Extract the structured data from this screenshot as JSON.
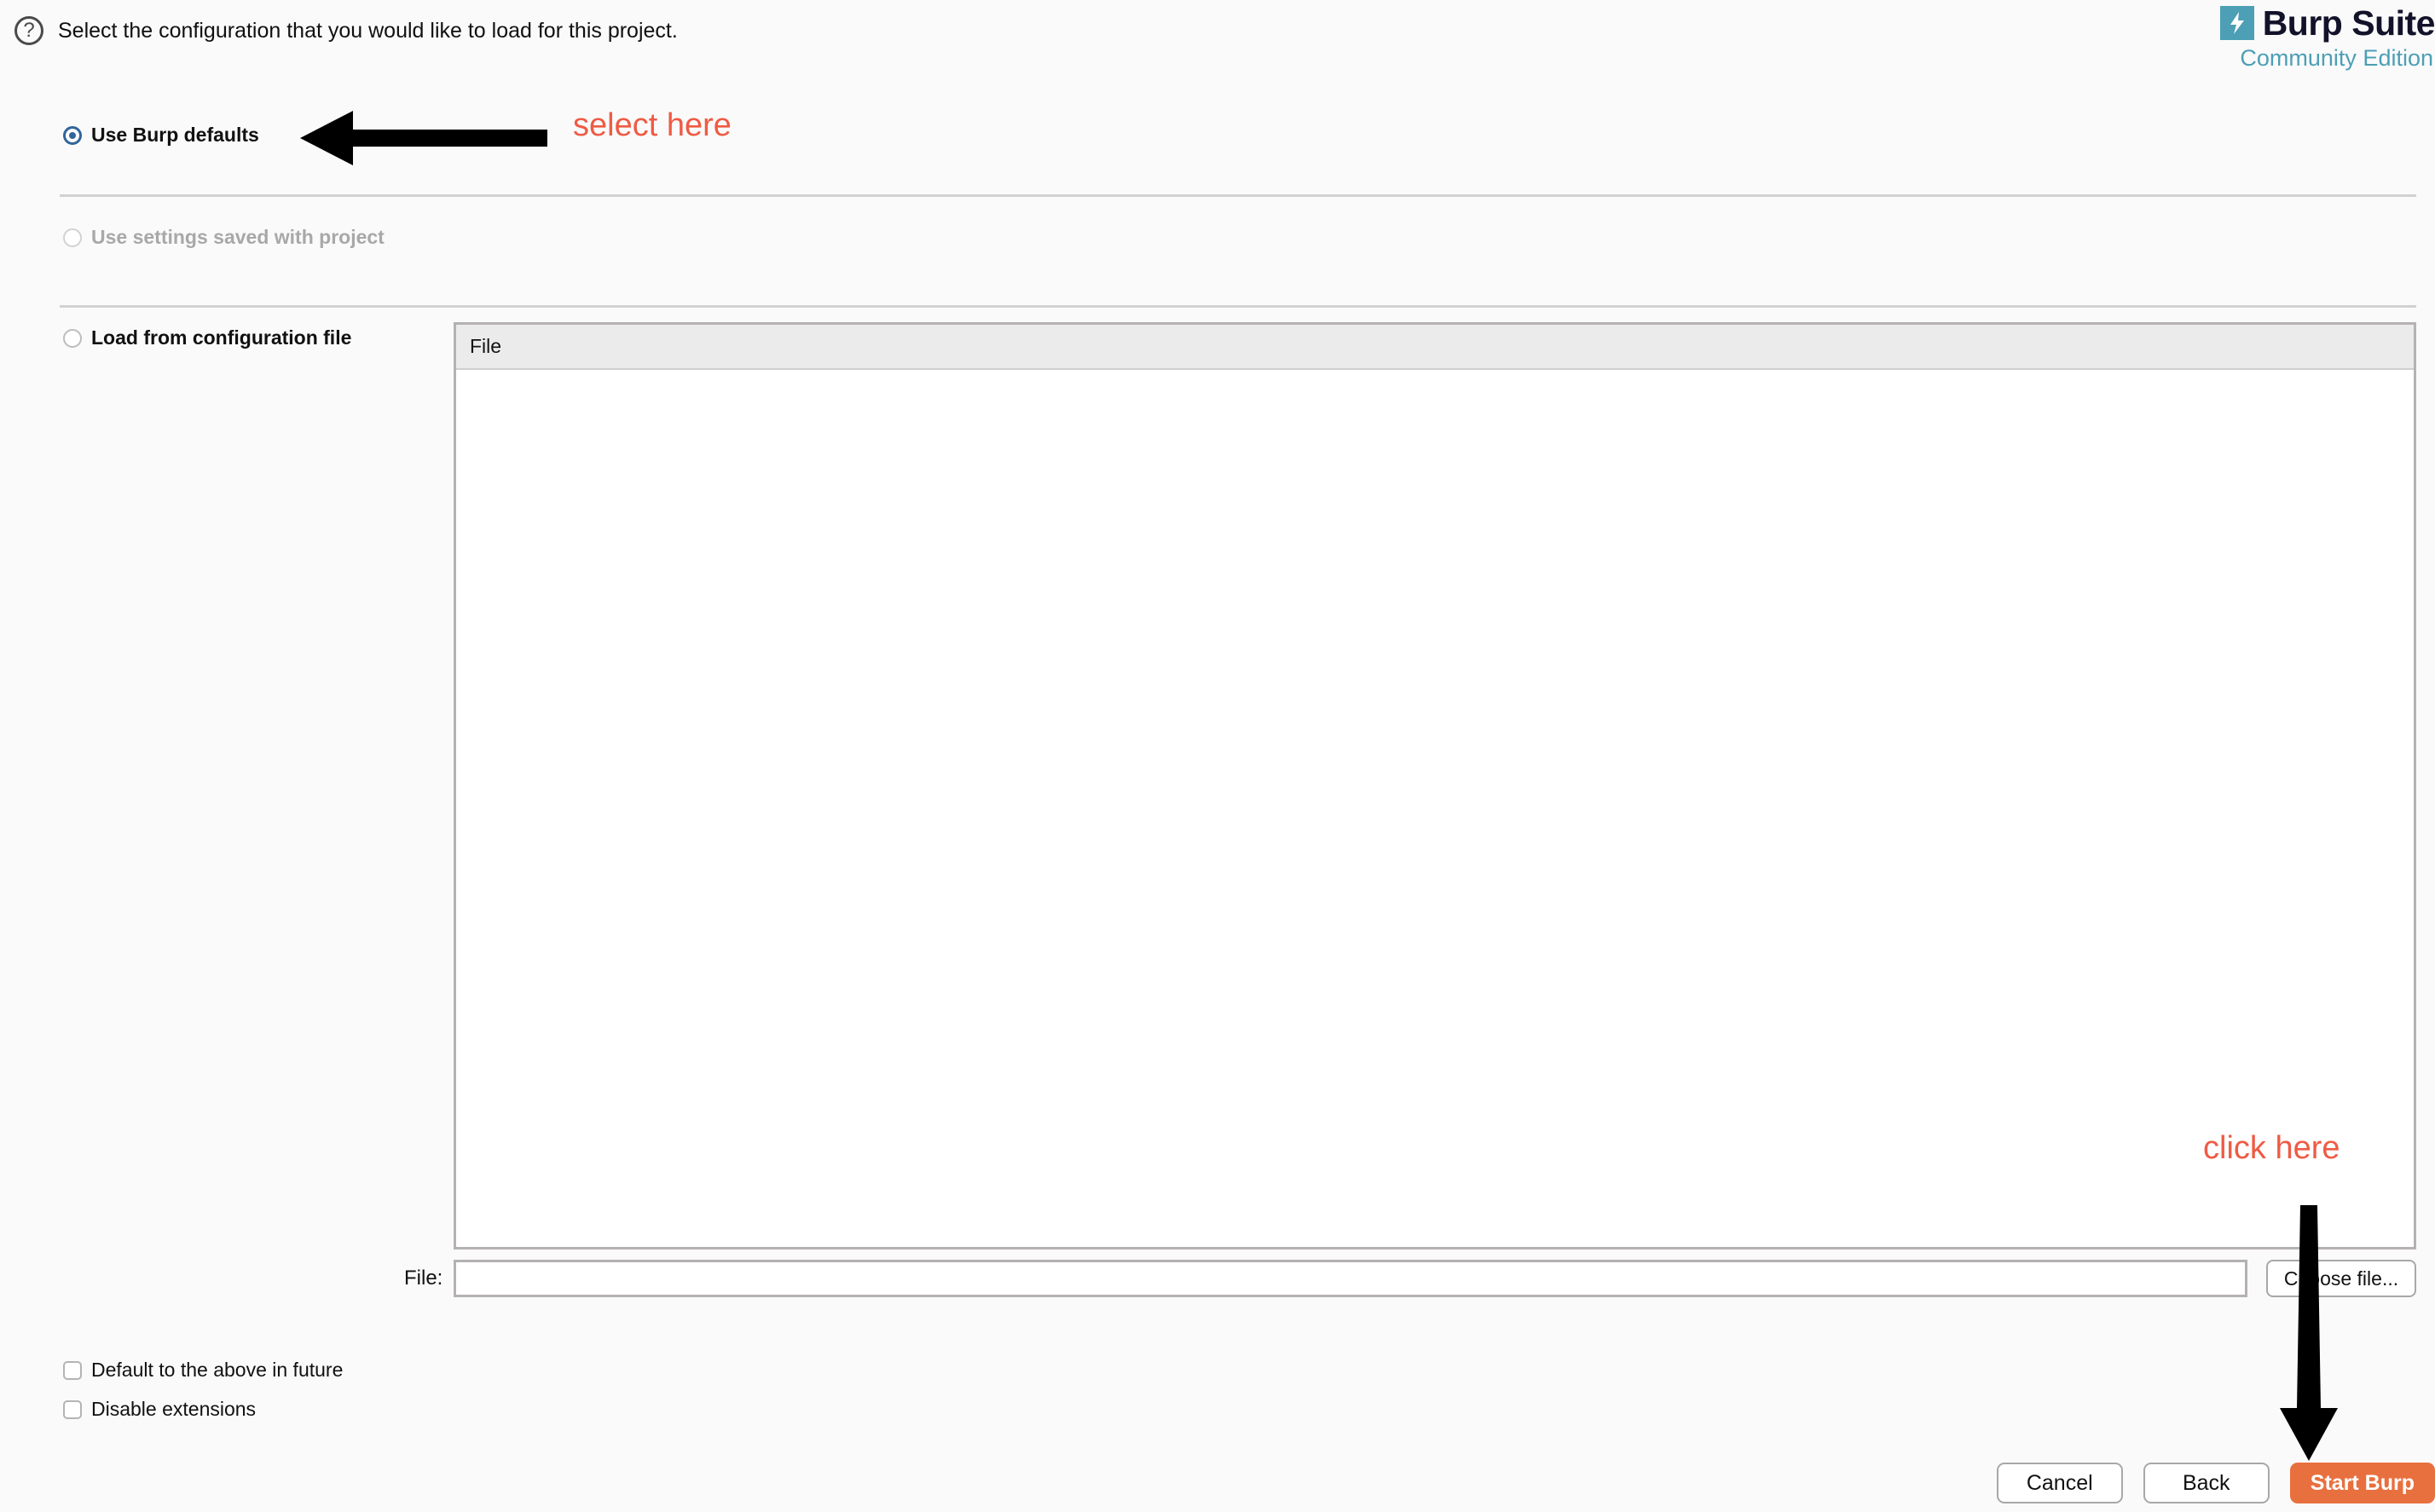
{
  "header": {
    "help_icon": "question-mark-circle-icon",
    "instruction": "Select the configuration that you would like to load for this project."
  },
  "brand": {
    "mark_icon": "lightning-bolt-icon",
    "name": "Burp Suite",
    "edition": "Community Edition",
    "mark_color": "#4c9fb5",
    "name_color": "#12122a",
    "edition_color": "#4c9fb5"
  },
  "options": [
    {
      "id": "use-burp-defaults",
      "label": "Use Burp defaults",
      "selected": true,
      "disabled": false
    },
    {
      "id": "use-settings-saved-with-project",
      "label": "Use settings saved with project",
      "selected": false,
      "disabled": true
    },
    {
      "id": "load-from-configuration-file",
      "label": "Load from configuration file",
      "selected": false,
      "disabled": false
    }
  ],
  "file_table": {
    "columns": [
      "File"
    ],
    "rows": []
  },
  "file_chooser": {
    "label": "File:",
    "value": "",
    "placeholder": "",
    "choose_button": "Choose file..."
  },
  "checkboxes": [
    {
      "id": "default-to-the-above-in-future",
      "label": "Default to the above in future",
      "checked": false
    },
    {
      "id": "disable-extensions",
      "label": "Disable extensions",
      "checked": false
    }
  ],
  "footer": {
    "cancel": "Cancel",
    "back": "Back",
    "start": "Start Burp",
    "start_color": "#e8703f"
  },
  "annotations": {
    "select_here": "select here",
    "click_here": "click here",
    "color": "#ef5b44",
    "arrow_left": "left-arrow-annotation",
    "arrow_down": "down-arrow-annotation"
  }
}
